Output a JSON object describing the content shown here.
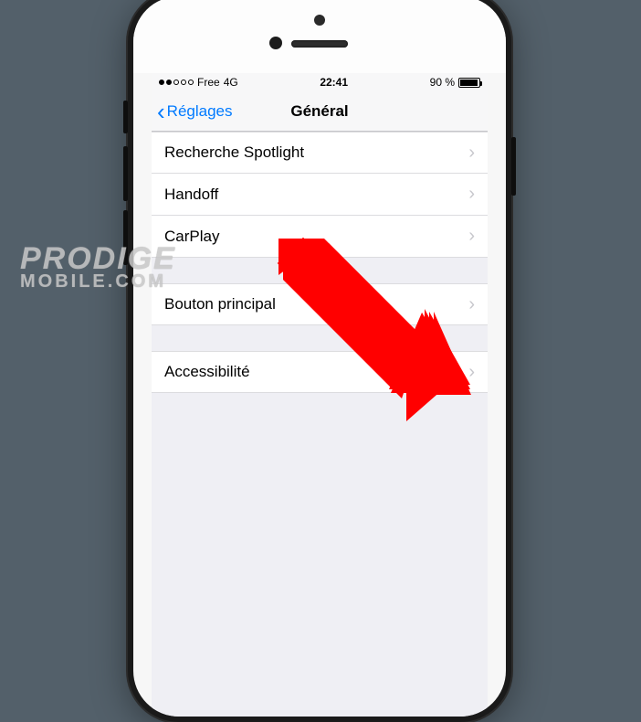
{
  "statusbar": {
    "carrier": "Free",
    "network": "4G",
    "time": "22:41",
    "battery_text": "90 %"
  },
  "navbar": {
    "back_label": "Réglages",
    "title": "Général"
  },
  "groups": [
    {
      "items": [
        {
          "label": "Recherche Spotlight"
        },
        {
          "label": "Handoff"
        },
        {
          "label": "CarPlay"
        }
      ]
    },
    {
      "items": [
        {
          "label": "Bouton principal"
        }
      ]
    },
    {
      "items": [
        {
          "label": "Accessibilité"
        }
      ]
    }
  ],
  "watermark": {
    "line1": "PRODIGE",
    "line2": "MOBILE.COM"
  }
}
